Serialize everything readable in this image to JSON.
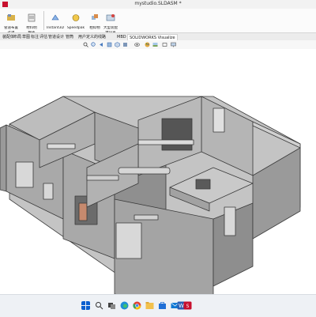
{
  "window": {
    "title": "mystudio.SLDASM *"
  },
  "ribbon": {
    "buttons": [
      {
        "label": "管道布置",
        "sub": "选项",
        "icon": "routing-options-icon"
      },
      {
        "label": "材料明",
        "sub": "细表",
        "icon": "bom-icon"
      },
      {
        "label": "Instant3D",
        "sub": "",
        "icon": "instant3d-icon"
      },
      {
        "label": "Speedpak",
        "sub": "",
        "icon": "speedpak-icon"
      },
      {
        "label": "相似物",
        "sub": "",
        "icon": "similar-parts-icon"
      },
      {
        "label": "大型装配",
        "sub": "体设置",
        "icon": "large-assembly-icon"
      }
    ]
  },
  "tabs": [
    "装配体",
    "布局",
    "草图",
    "标注",
    "评估",
    "管道设计",
    "管筒",
    "用户定义的线路",
    "MBD",
    "SOLIDWORKS Visualize"
  ],
  "active_tab": "SOLIDWORKS Visualize",
  "view_tools": [
    "search-view-icon",
    "zoom-icon",
    "previous-view-icon",
    "section-view-icon",
    "view-orientation-icon",
    "display-style-icon",
    "hide-show-icon",
    "edit-appearance-icon",
    "scene-icon",
    "view-settings-icon",
    "monitor-icon"
  ],
  "taskbar": {
    "apps": [
      "windows-start-icon",
      "search-icon",
      "task-view-icon",
      "edge-icon",
      "chrome-icon",
      "file-explorer-icon",
      "store-icon",
      "mail-icon",
      "word-icon",
      "solidworks-icon"
    ],
    "colors": {
      "accent": "#0a5fcf",
      "solidworks": "#c8102e"
    }
  }
}
